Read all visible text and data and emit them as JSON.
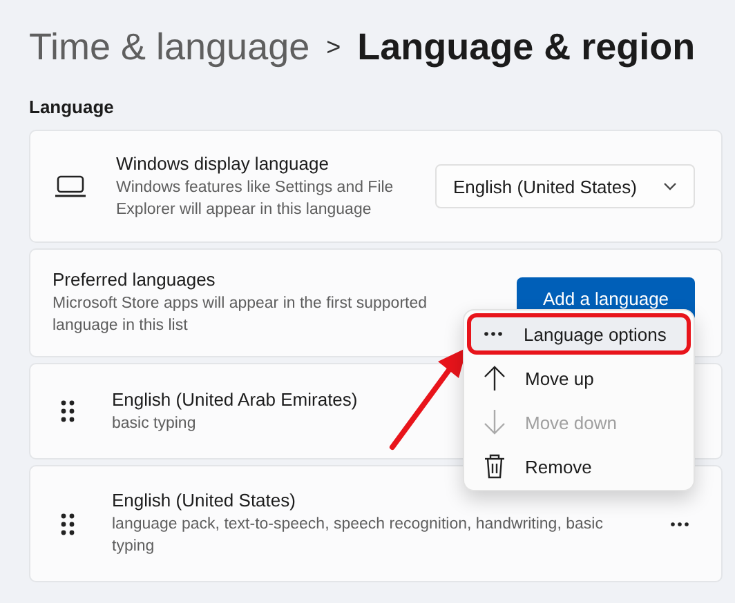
{
  "breadcrumb": [
    {
      "label": "Time & language",
      "current": false
    },
    {
      "label": "Language & region",
      "current": true
    }
  ],
  "breadcrumb_separator": ">",
  "section_label": "Language",
  "display_language": {
    "title": "Windows display language",
    "description": "Windows features like Settings and File Explorer will appear in this language",
    "value": "English (United States)"
  },
  "preferred": {
    "title": "Preferred languages",
    "description": "Microsoft Store apps will appear in the first supported language in this list",
    "button": "Add a language"
  },
  "languages": [
    {
      "name": "English (United Arab Emirates)",
      "features": "basic typing"
    },
    {
      "name": "English (United States)",
      "features": "language pack, text-to-speech, speech recognition, handwriting, basic typing",
      "more": true
    }
  ],
  "context_menu": [
    {
      "kind": "more",
      "label": "Language options",
      "selected": true,
      "disabled": false,
      "annotated": true
    },
    {
      "kind": "up",
      "label": "Move up",
      "selected": false,
      "disabled": false,
      "annotated": false
    },
    {
      "kind": "down",
      "label": "Move down",
      "selected": false,
      "disabled": true,
      "annotated": false
    },
    {
      "kind": "remove",
      "label": "Remove",
      "selected": false,
      "disabled": false,
      "annotated": false
    }
  ]
}
